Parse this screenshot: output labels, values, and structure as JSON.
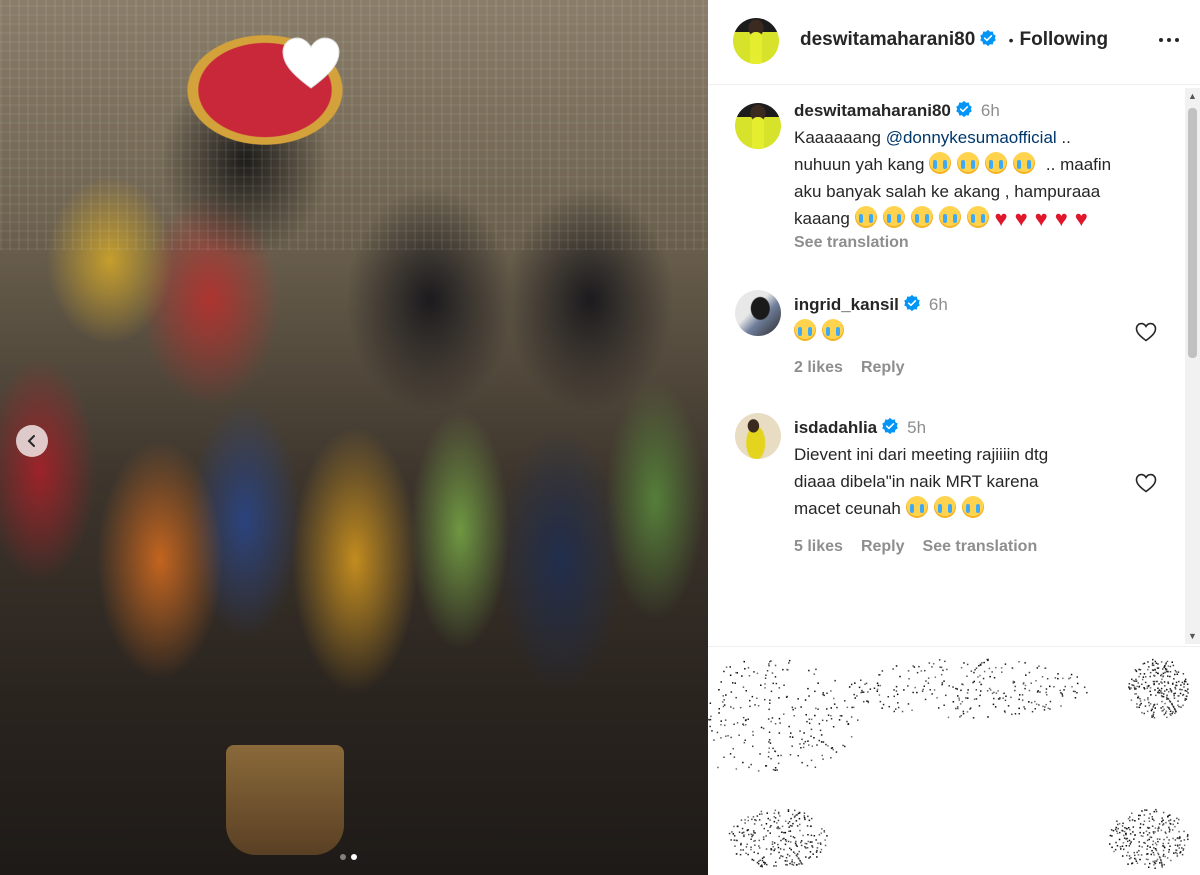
{
  "post": {
    "carousel": {
      "dot_count": 2,
      "active_index": 1
    }
  },
  "header": {
    "username": "deswitamaharani80",
    "separator": "•",
    "follow_status": "Following"
  },
  "caption": {
    "username": "deswitamaharani80",
    "time": "6h",
    "text_before_mention": "Kaaaaaang ",
    "mention": "@donnykesumaofficial",
    "text_line1_after": " ..",
    "text_line2": "nuhuun yah kang",
    "text_line2_after": " .. maafin",
    "text_line3": "aku banyak salah ke akang , hampuraaa",
    "text_line4": "kaaang",
    "see_translation": "See translation",
    "emoji_after_line2": 4,
    "emoji_after_line4": 5,
    "hearts_after_line4": 5
  },
  "comments": [
    {
      "username": "ingrid_kansil",
      "time": "6h",
      "emoji_count": 2,
      "likes": "2 likes",
      "reply": "Reply"
    },
    {
      "username": "isdadahlia",
      "time": "5h",
      "line1": "Dievent ini dari meeting rajiiiin dtg",
      "line2": "diaaa dibela\"in naik MRT karena",
      "line3": "macet ceunah",
      "emoji_count": 3,
      "likes": "5 likes",
      "reply": "Reply",
      "see_translation": "See translation"
    }
  ],
  "colors": {
    "verified": "#0095f6",
    "mention": "#00376b",
    "muted": "#8e8e8e",
    "heart_red": "#e0162b"
  }
}
